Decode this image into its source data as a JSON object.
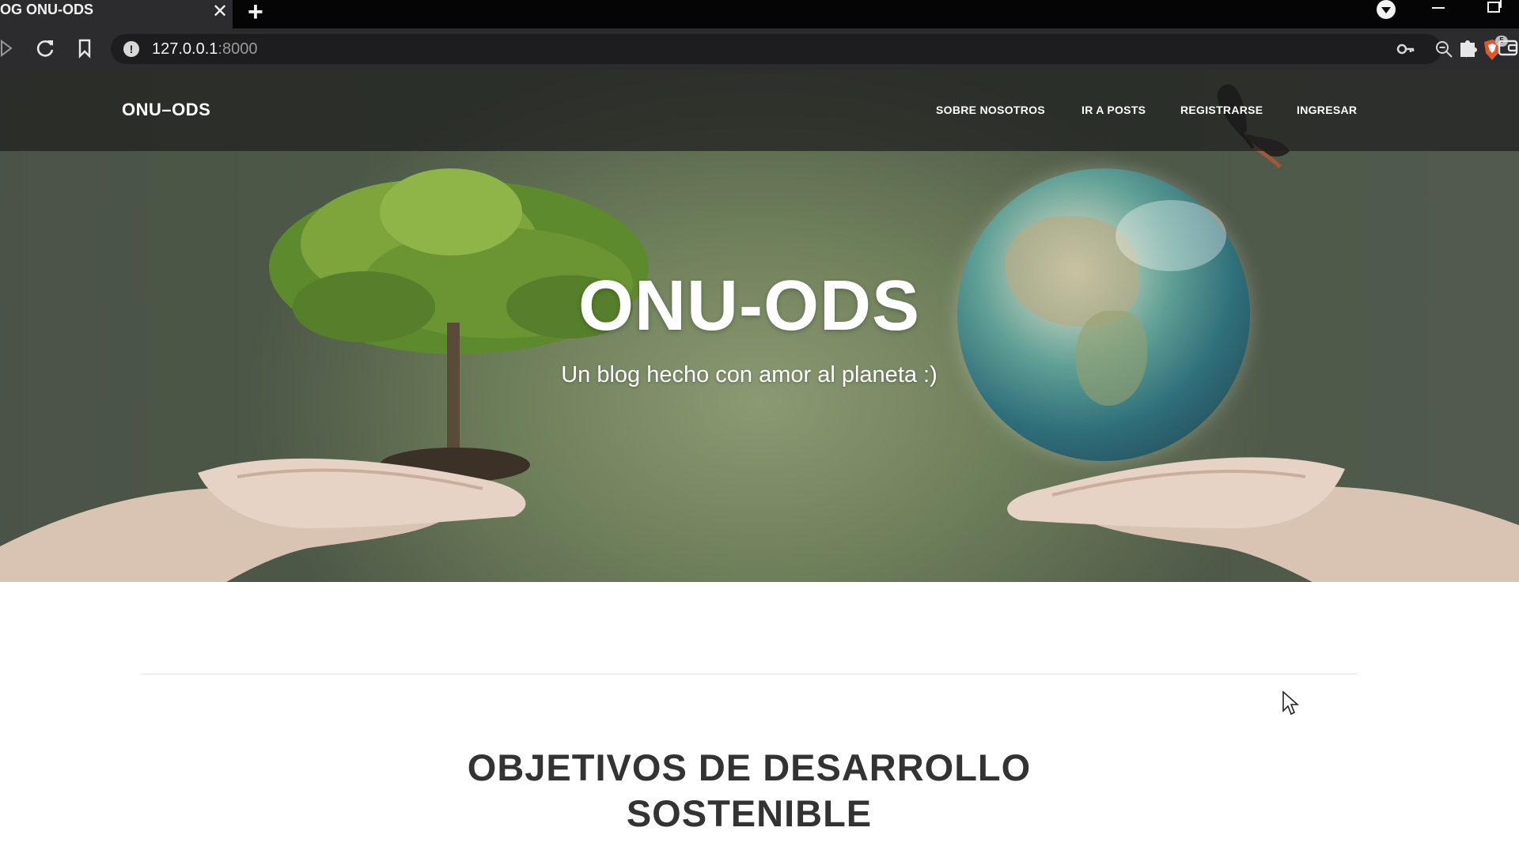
{
  "browser": {
    "tab_title": "OG ONU-ODS",
    "tab_close": "✕",
    "new_tab": "+",
    "url_host": "127.0.0.1",
    "url_port": ":8000",
    "shield_badge": "5"
  },
  "nav": {
    "brand": "ONU–ODS",
    "links": [
      "SOBRE NOSOTROS",
      "IR A POSTS",
      "REGISTRARSE",
      "INGRESAR"
    ]
  },
  "hero": {
    "title": "ONU-ODS",
    "subtitle": "Un blog hecho con amor al planeta :)"
  },
  "section": {
    "title_line1": "OBJETIVOS DE DESARROLLO",
    "title_line2": "SOSTENIBLE"
  },
  "icons": {
    "back": "play-triangle-icon",
    "reload": "reload-icon",
    "bookmark": "bookmark-icon",
    "site_info": "info-icon",
    "password": "key-icon",
    "zoom": "zoom-out-icon",
    "brave": "brave-shield-icon",
    "rewards": "brave-rewards-icon",
    "extensions": "puzzle-icon",
    "wallet": "wallet-icon"
  }
}
